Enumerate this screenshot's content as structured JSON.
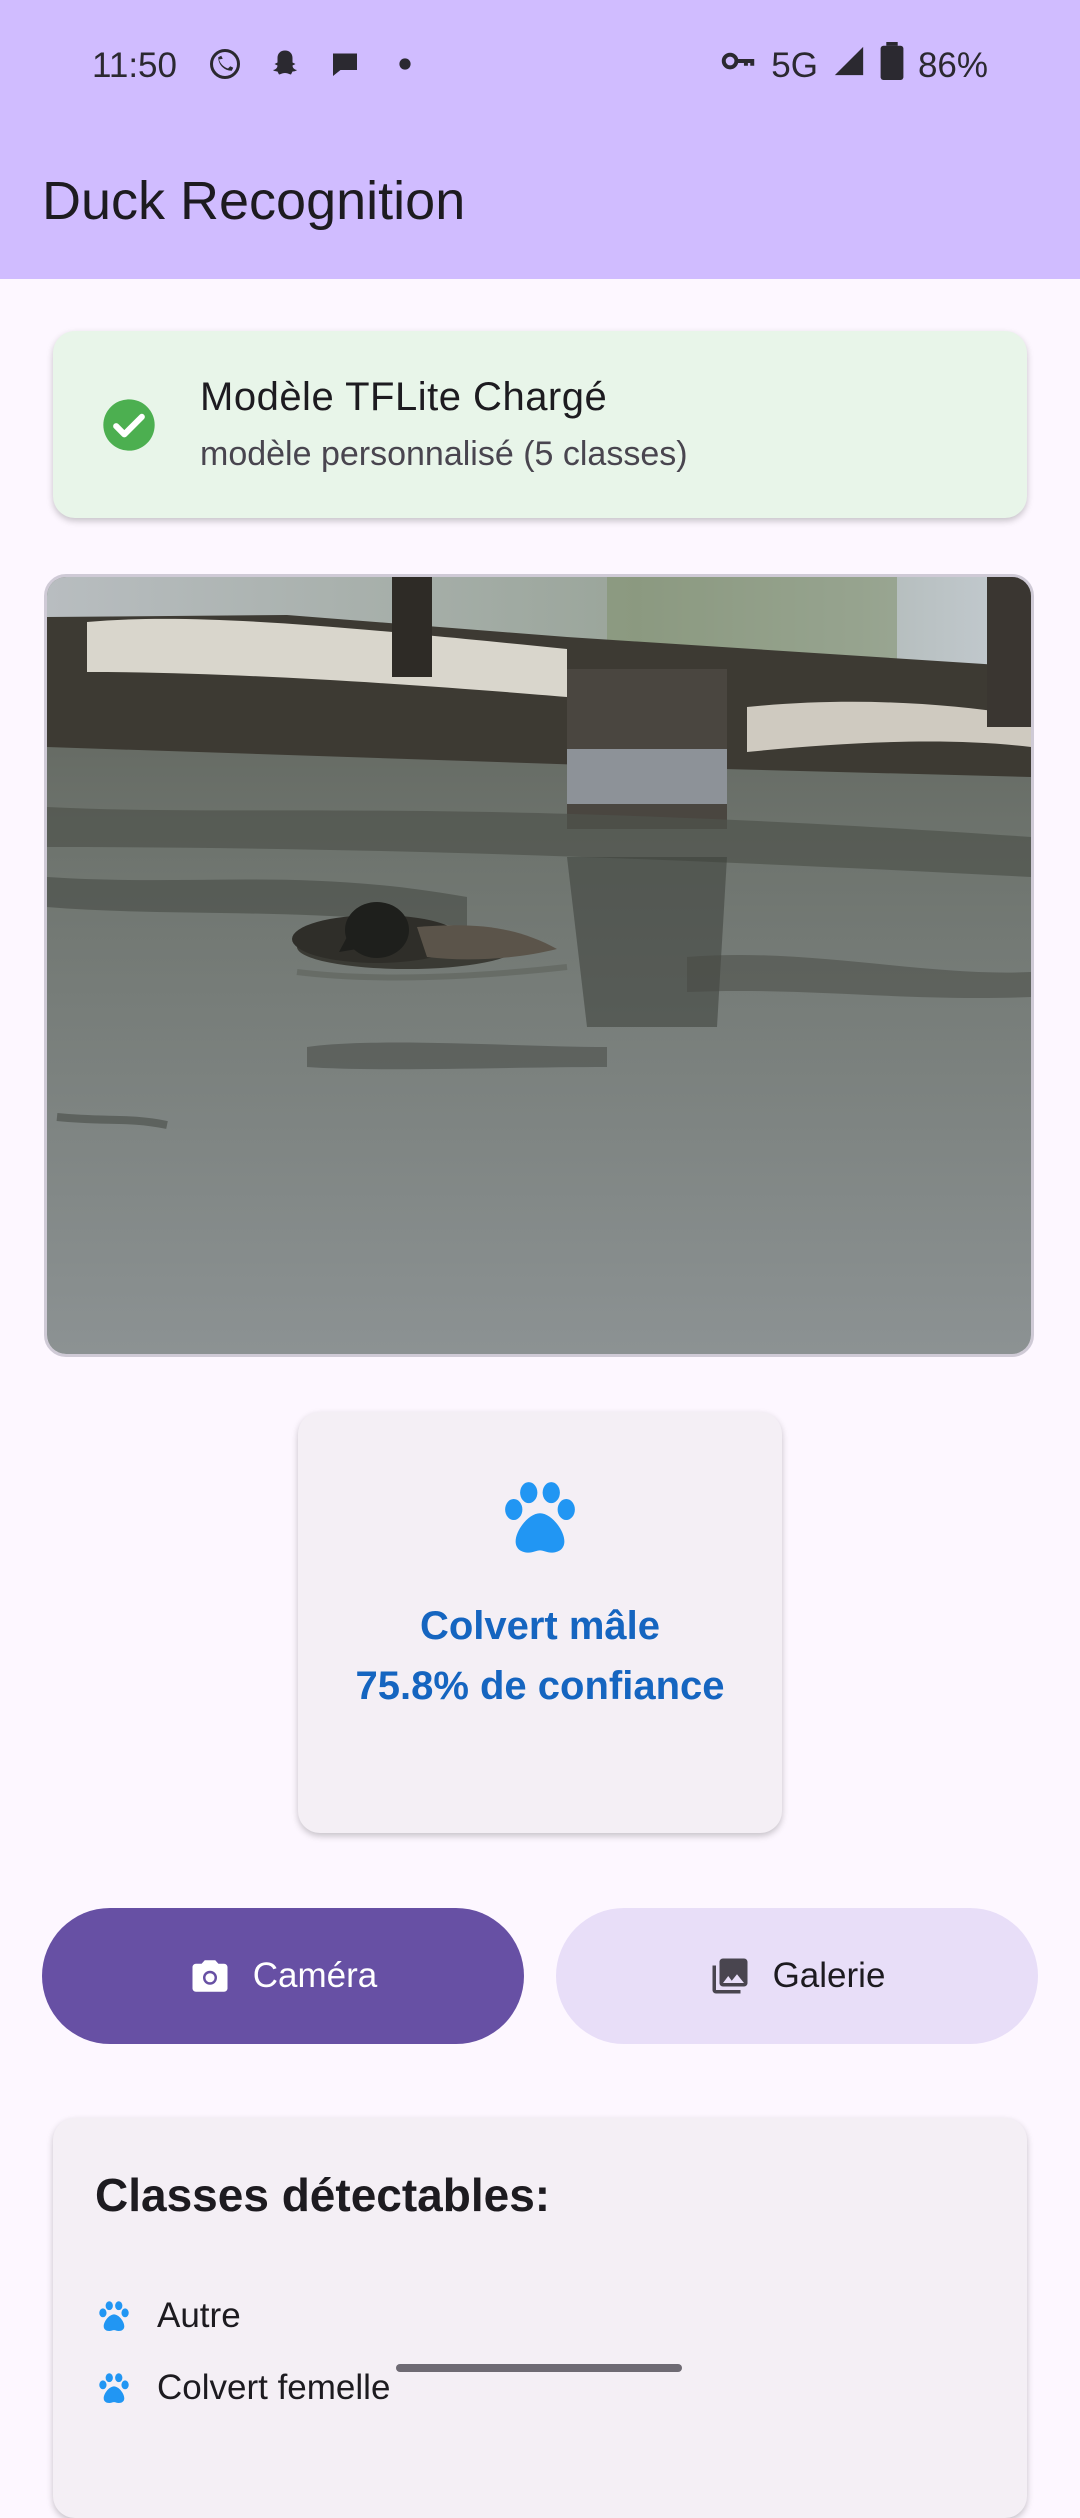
{
  "status_bar": {
    "time": "11:50",
    "network": "5G",
    "battery": "86%"
  },
  "app_bar": {
    "title": "Duck Recognition"
  },
  "model_status": {
    "title": "Modèle TFLite Chargé",
    "subtitle": "modèle personnalisé (5 classes)",
    "icon": "check-circle-icon"
  },
  "result": {
    "label": "Colvert mâle",
    "confidence_text": "75.8% de confiance",
    "icon": "paw-icon"
  },
  "actions": {
    "camera_label": "Caméra",
    "gallery_label": "Galerie"
  },
  "classes": {
    "title": "Classes détectables:",
    "items": [
      "Autre",
      "Colvert femelle"
    ]
  },
  "colors": {
    "app_bar": "#d0bcff",
    "background": "#fdf7ff",
    "accent": "#6750a4",
    "result_text": "#1565c0",
    "icon_blue": "#2196f3",
    "success_green": "#4caf50"
  }
}
